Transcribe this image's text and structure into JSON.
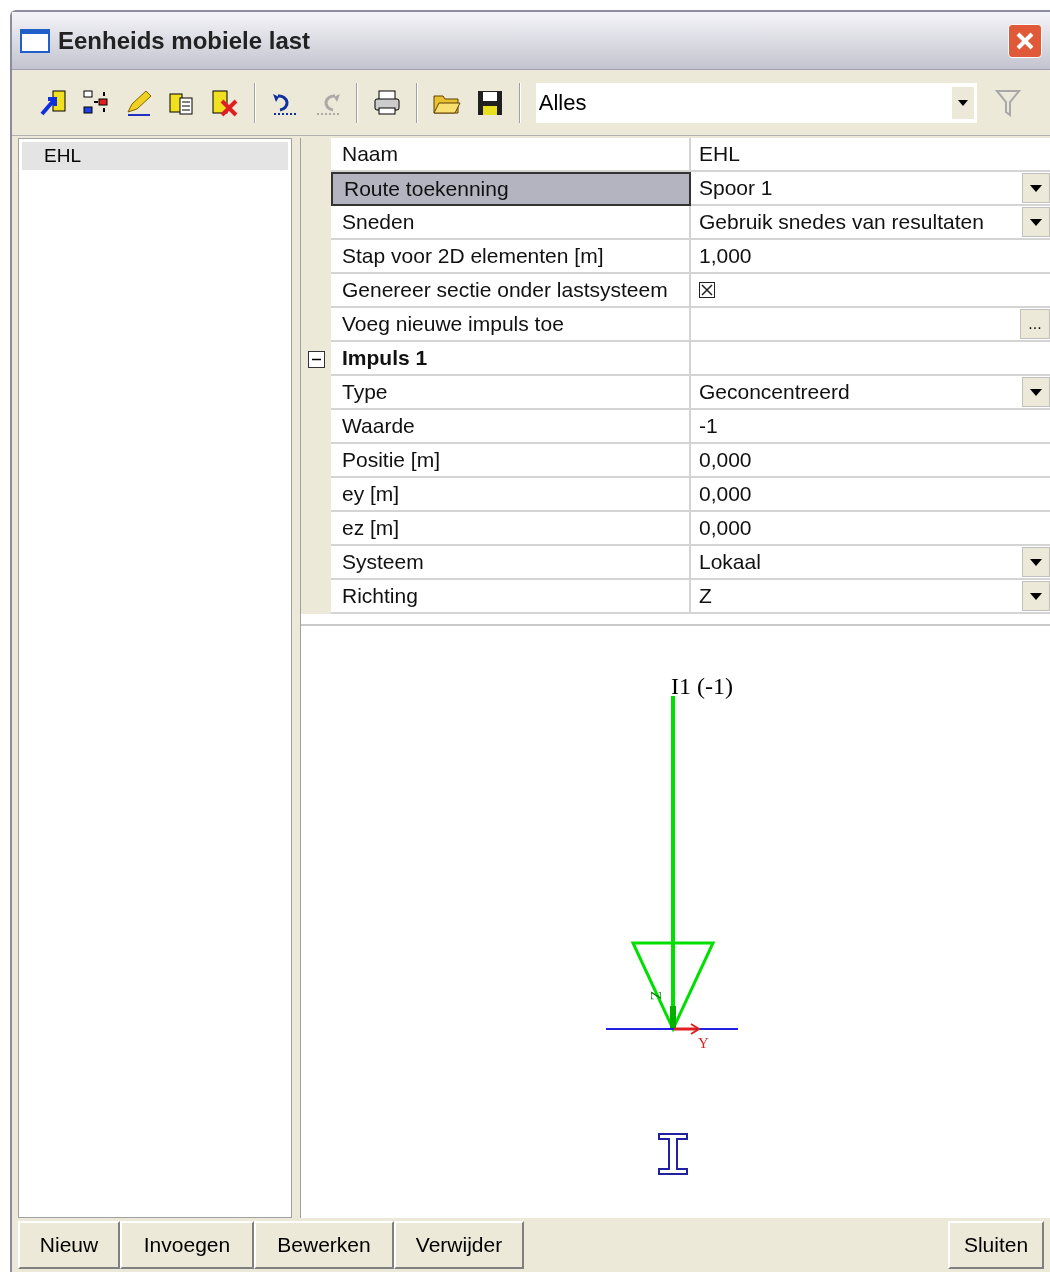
{
  "window": {
    "title": "Eenheids mobiele last"
  },
  "toolbar": {
    "buttons": [
      {
        "disabled": false
      },
      {
        "disabled": false
      },
      {
        "disabled": false
      },
      {
        "disabled": false
      },
      {
        "disabled": false
      },
      {
        "disabled": false
      },
      {
        "disabled": true
      },
      {
        "disabled": false
      },
      {
        "disabled": false
      },
      {
        "disabled": false
      }
    ],
    "filter": {
      "value": "Alles"
    },
    "filter_button": {
      "disabled": true
    }
  },
  "list": [
    {
      "label": "EHL",
      "selected": true
    }
  ],
  "properties": [
    {
      "kind": "text",
      "label": "Naam",
      "value": "EHL",
      "selected": false
    },
    {
      "kind": "dropdown",
      "label": "Route toekenning",
      "value": "Spoor 1",
      "selected": true
    },
    {
      "kind": "dropdown",
      "label": "Sneden",
      "value": "Gebruik snedes van resultaten",
      "selected": false
    },
    {
      "kind": "text",
      "label": "Stap voor 2D elementen [m]",
      "value": "1,000",
      "selected": false
    },
    {
      "kind": "checkbox",
      "label": "Genereer sectie onder lastsysteem",
      "checked": true,
      "selected": false
    },
    {
      "kind": "button",
      "label": "Voeg nieuwe impuls toe",
      "button": "...",
      "selected": false
    },
    {
      "kind": "group",
      "label": "Impuls 1",
      "expanded": true,
      "selected": false,
      "children": [
        {
          "kind": "dropdown",
          "label": "Type",
          "value": "Geconcentreerd",
          "selected": false
        },
        {
          "kind": "text",
          "label": "Waarde",
          "value": "-1",
          "selected": false
        },
        {
          "kind": "text",
          "label": "Positie [m]",
          "value": "0,000",
          "selected": false
        },
        {
          "kind": "text",
          "label": "ey [m]",
          "value": "0,000",
          "selected": false
        },
        {
          "kind": "text",
          "label": "ez [m]",
          "value": "0,000",
          "selected": false
        },
        {
          "kind": "dropdown",
          "label": "Systeem",
          "value": "Lokaal",
          "selected": false
        },
        {
          "kind": "dropdown",
          "label": "Richting",
          "value": "Z",
          "selected": false
        }
      ]
    }
  ],
  "diagram": {
    "load_label": "I1 (-1)",
    "z_axis": "Z",
    "y_axis": "Y"
  },
  "buttons": [
    {
      "label": "Nieuw"
    },
    {
      "label": "Invoegen"
    },
    {
      "label": "Bewerken"
    },
    {
      "label": "Verwijder"
    }
  ],
  "close_button": {
    "label": "Sluiten"
  }
}
